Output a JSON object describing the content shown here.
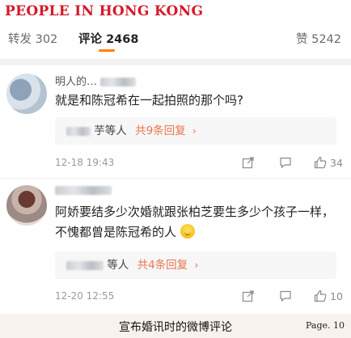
{
  "banner": "PEOPLE IN HONG KONG",
  "tabs": {
    "repost": {
      "label": "转发",
      "count": "302"
    },
    "comment": {
      "label": "评论",
      "count": "2468"
    },
    "like": {
      "label": "赞",
      "count": "5242"
    }
  },
  "comments": [
    {
      "username_visible": "明人的…",
      "text": "就是和陈冠希在一起拍照的那个吗?",
      "replies_who": "芋等人",
      "replies_count": "共9条回复",
      "replies_chevron": "›",
      "time": "12-18 19:43",
      "likes": "34"
    },
    {
      "username_visible": "",
      "text": "阿娇要结多少次婚就跟张柏芝要生多少个孩子一样，不愧都曾是陈冠希的人",
      "replies_who": "等人",
      "replies_count": "共4条回复",
      "replies_chevron": "›",
      "time": "12-20 12:55",
      "likes": "10"
    }
  ],
  "footer": {
    "caption": "宣布婚讯时的微博评论",
    "page": "Page. 10"
  },
  "colors": {
    "banner": "#d4192a",
    "accent": "#eb7350",
    "tab_underline": "#ff8200"
  },
  "icons": [
    "share-icon",
    "reply-icon",
    "thumbs-up-icon",
    "emoji-smile-icon"
  ]
}
